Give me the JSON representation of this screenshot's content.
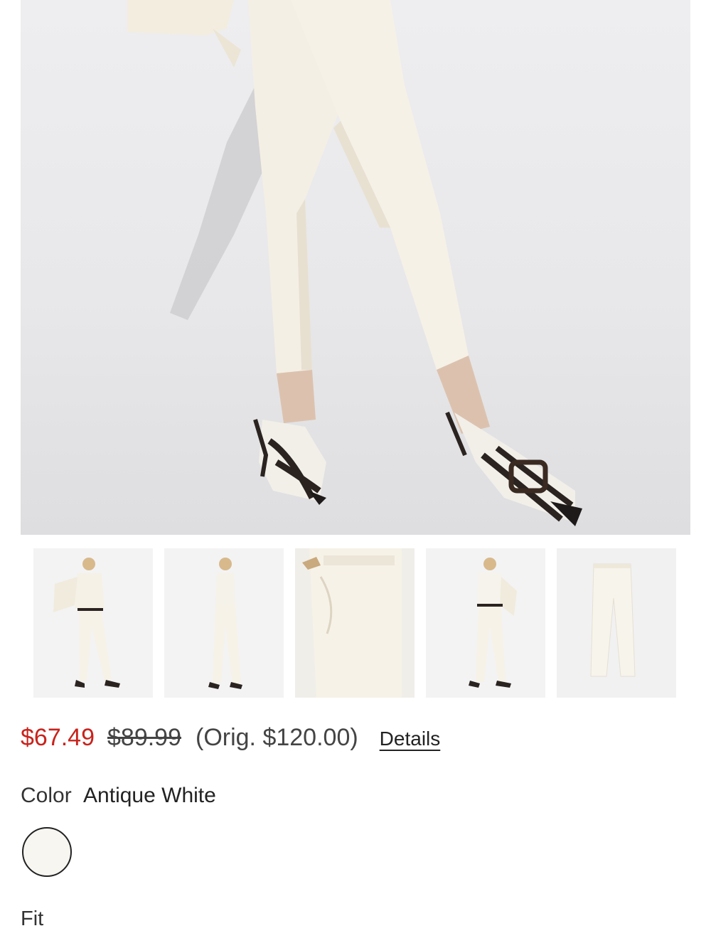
{
  "product": {
    "sale_price": "$67.49",
    "was_price": "$89.99",
    "orig_price": "(Orig. $120.00)",
    "details_label": "Details"
  },
  "color": {
    "label": "Color",
    "value": "Antique White",
    "swatch_hex": "#f7f6f1"
  },
  "fit": {
    "label": "Fit"
  },
  "gallery": {
    "thumbnails": [
      "front-full-outfit",
      "back-view",
      "pocket-detail",
      "front-walking",
      "flat-lay"
    ]
  },
  "colors": {
    "sale": "#c8231c",
    "text": "#222222"
  }
}
